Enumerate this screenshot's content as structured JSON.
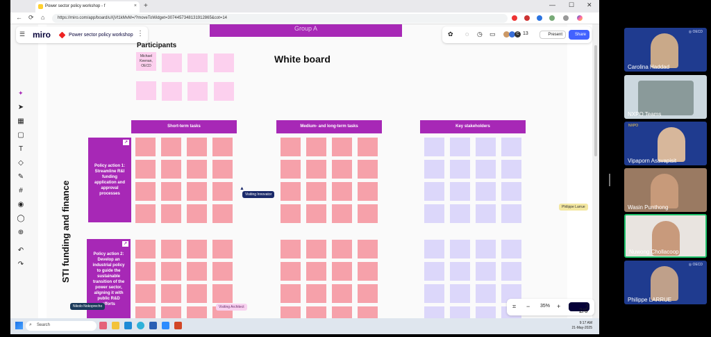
{
  "browser": {
    "tab_title": "Power sector policy workshop - f",
    "tab_close": "×",
    "newtab": "+",
    "url": "https://miro.com/app/board/uXjVt1kMvM=/?moveToWidget=3074457348131912865&cot=14",
    "win_min": "—",
    "win_max": "☐",
    "win_close": "✕"
  },
  "miro": {
    "logo": "miro",
    "board_name": "Power sector policy workshop",
    "group_banner": "Group A",
    "user_count": "13",
    "present_label": "Present",
    "share_label": "Share",
    "participants_title": "Participants",
    "participant_note": "Michael Keenan, OECD",
    "whiteboard_title": "White board",
    "headers": [
      "Short-term tasks",
      "Medium- and long-term tasks",
      "Key stakeholders"
    ],
    "action1": "Policy action 1: Streamline R&I funding application and approval processes",
    "action2": "Policy action 2: Develop an industrial policy to guide the sustainable transition of the power sector, aligning it with public R&D efforts",
    "vertical_label": "STI funding and finance",
    "cursors": {
      "visiting_innovator": "Visiting Innovator",
      "philippe": "Philippe Larrue",
      "nikolo": "Nikolo Nokoprecho",
      "visiting_architect": "Visiting Architect"
    },
    "zoom": "35%",
    "page_indicator": "2/6",
    "help": "?"
  },
  "taskbar": {
    "search_placeholder": "Search",
    "time": "9:17 AM",
    "date": "21-May-2025"
  },
  "participants": [
    {
      "name": "Carolina Haddad"
    },
    {
      "name": "NXPO Teams"
    },
    {
      "name": "Vipaporn Asavapisit"
    },
    {
      "name": "Wasin Punthong"
    },
    {
      "name": "Nuwong Chollacoop"
    },
    {
      "name": "Philippe LARRUE"
    }
  ],
  "colors": {
    "accent": "#a728b6",
    "sticky_pink": "#f6a1aa",
    "sticky_lavender": "#dcd7fa",
    "share_blue": "#4262ff"
  }
}
